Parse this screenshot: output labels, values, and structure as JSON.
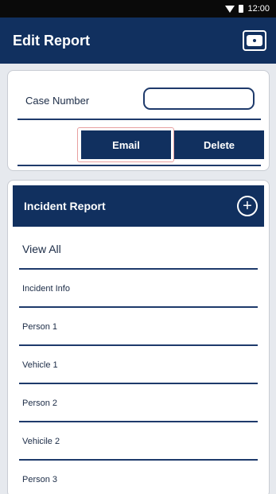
{
  "status_bar": {
    "time": "12:00"
  },
  "app_bar": {
    "title": "Edit Report",
    "camera_icon": "camera-icon"
  },
  "case": {
    "label": "Case Number",
    "value": ""
  },
  "actions": {
    "email_label": "Email",
    "delete_label": "Delete"
  },
  "incident": {
    "header": "Incident Report",
    "add_icon": "plus-circle-icon",
    "view_all": "View All",
    "items": [
      {
        "label": "Incident Info"
      },
      {
        "label": "Person 1"
      },
      {
        "label": "Vehicle 1"
      },
      {
        "label": "Person 2"
      },
      {
        "label": "Vehicile 2"
      },
      {
        "label": "Person 3"
      }
    ]
  },
  "colors": {
    "primary": "#11305f",
    "background": "#e6e9ee",
    "highlight": "#e8a0a0"
  }
}
